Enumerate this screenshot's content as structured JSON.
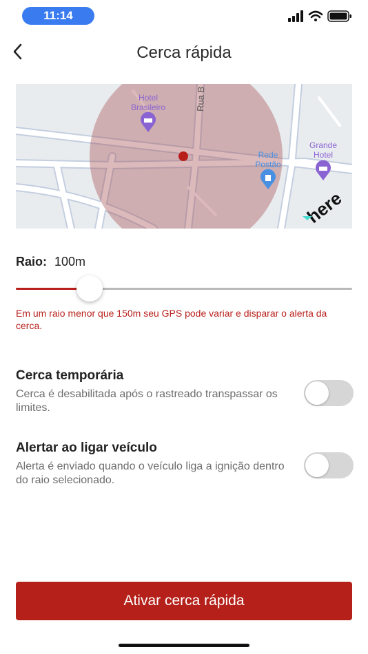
{
  "status_bar": {
    "time": "11:14",
    "icons": [
      "cellular-signal-icon",
      "wifi-icon",
      "battery-icon"
    ]
  },
  "header": {
    "title": "Cerca rápida",
    "back_icon": "chevron-left-icon"
  },
  "map": {
    "labels": {
      "hotel_brasileiro_line1": "Hotel",
      "hotel_brasileiro_line2": "Brasileiro",
      "grande_hotel_line1": "Grande",
      "grande_hotel_line2": "Hotel",
      "rede_postao_line1": "Rede",
      "rede_postao_line2": "Postão",
      "street": "Rua B",
      "brand": "here"
    },
    "colors": {
      "background": "#e9ecef",
      "road": "#ffffff",
      "road_outline": "#c3cee0",
      "fence_fill": "#a4494d",
      "center_marker": "#b81f1a",
      "poi_marker": "#8a63d2",
      "fuel_marker": "#4a90e2"
    }
  },
  "radius": {
    "label": "Raio:",
    "value": "100m",
    "slider_fraction": 0.22,
    "warning": "Em um raio menor que 150m seu GPS pode variar e disparar o alerta da cerca."
  },
  "options": [
    {
      "title": "Cerca temporária",
      "description": "Cerca é desabilitada após o rastreado transpassar os limites.",
      "enabled": false
    },
    {
      "title": "Alertar ao ligar veículo",
      "description": "Alerta é enviado quando o veículo liga a ignição dentro do raio selecionado.",
      "enabled": false
    }
  ],
  "action": {
    "label": "Ativar cerca rápida",
    "color": "#b5211a"
  }
}
